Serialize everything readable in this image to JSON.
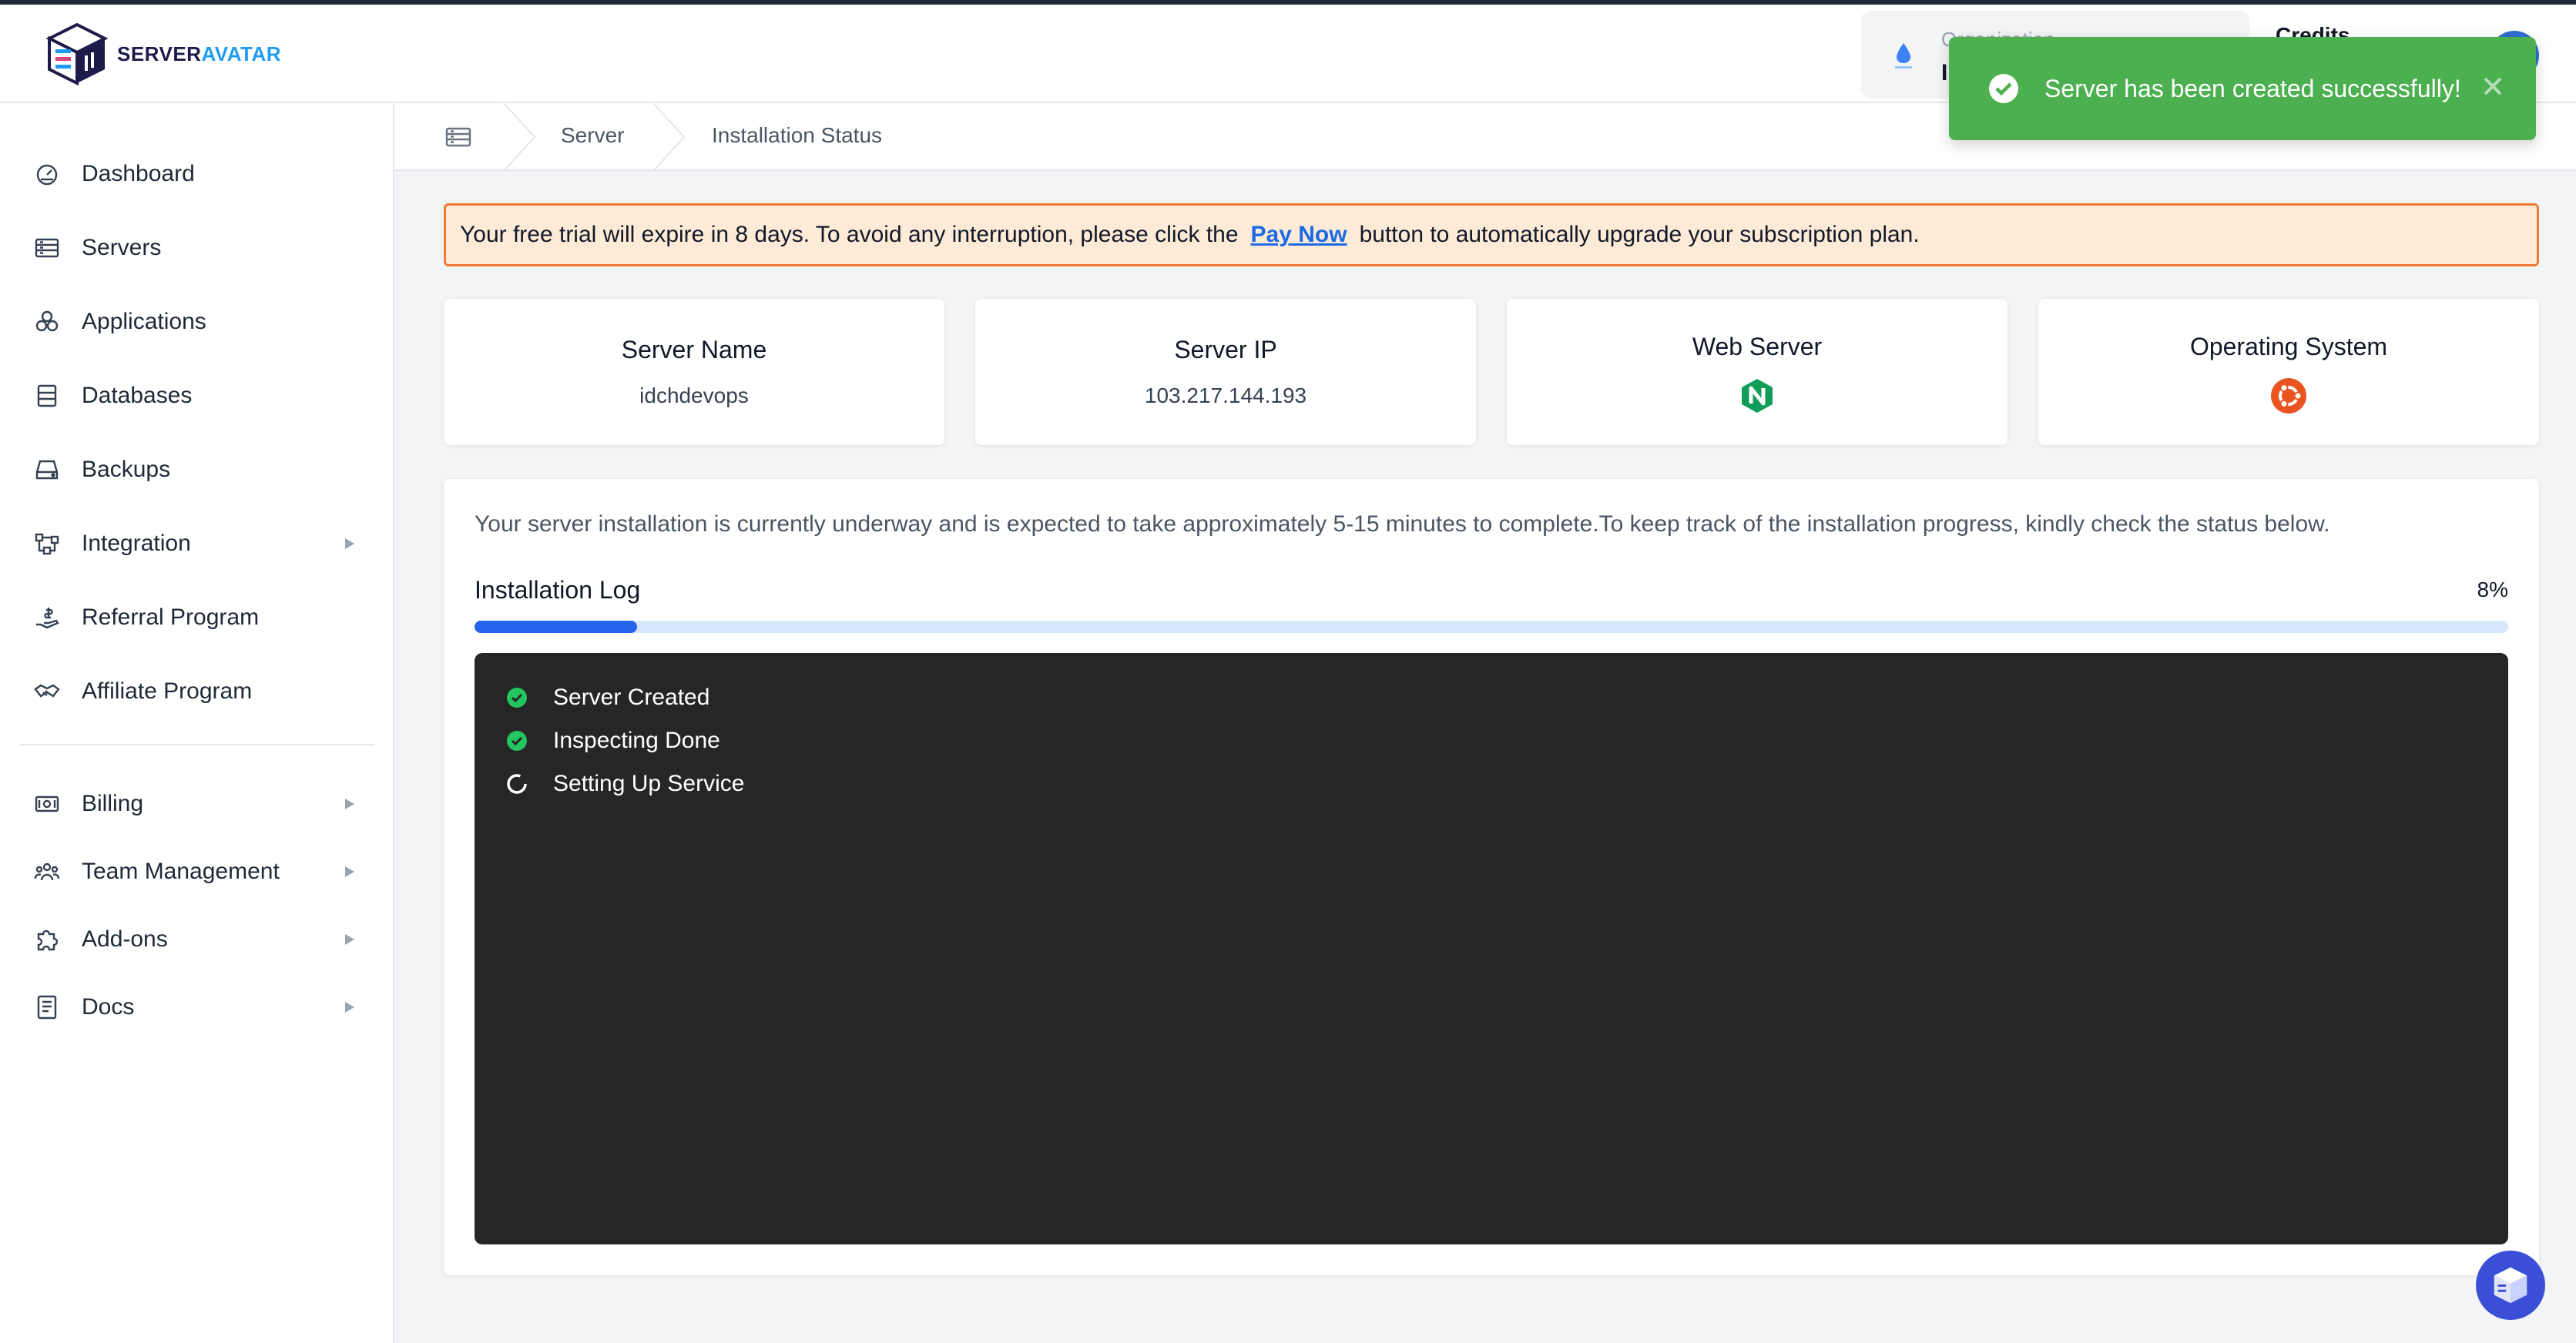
{
  "brand": {
    "name_part1": "SERVER",
    "name_part2": "AVATAR"
  },
  "header": {
    "org_label": "Organization",
    "org_value": "I",
    "credits_label": "Credits"
  },
  "toast": {
    "message": "Server has been created successfully!",
    "color": "#4caf50"
  },
  "sidebar": {
    "items": [
      {
        "label": "Dashboard",
        "icon": "dashboard-icon"
      },
      {
        "label": "Servers",
        "icon": "server-icon"
      },
      {
        "label": "Applications",
        "icon": "applications-icon"
      },
      {
        "label": "Databases",
        "icon": "database-icon"
      },
      {
        "label": "Backups",
        "icon": "backup-icon"
      },
      {
        "label": "Integration",
        "icon": "integration-icon"
      },
      {
        "label": "Referral Program",
        "icon": "referral-icon"
      },
      {
        "label": "Affiliate Program",
        "icon": "affiliate-icon"
      },
      {
        "label": "Billing",
        "icon": "billing-icon"
      },
      {
        "label": "Team Management",
        "icon": "team-icon"
      },
      {
        "label": "Add-ons",
        "icon": "addons-icon"
      },
      {
        "label": "Docs",
        "icon": "docs-icon"
      }
    ]
  },
  "breadcrumb": {
    "server": "Server",
    "current": "Installation Status"
  },
  "trial": {
    "before": "Your free trial will expire in 8 days. To avoid any interruption, please click the",
    "link": "Pay Now",
    "after": "button to automatically upgrade your subscription plan."
  },
  "cards": {
    "server_name": {
      "title": "Server Name",
      "value": "idchdevops"
    },
    "server_ip": {
      "title": "Server IP",
      "value": "103.217.144.193"
    },
    "web_server": {
      "title": "Web Server",
      "icon": "nginx-icon"
    },
    "os": {
      "title": "Operating System",
      "icon": "ubuntu-icon"
    }
  },
  "install": {
    "description": "Your server installation is currently underway and is expected to take approximately 5-15 minutes to complete.To keep track of the installation progress, kindly check the status below.",
    "log_title": "Installation Log",
    "progress_text": "8%",
    "progress": 0.08,
    "steps": [
      {
        "label": "Server Created",
        "status": "done"
      },
      {
        "label": "Inspecting Done",
        "status": "done"
      },
      {
        "label": "Setting Up Service",
        "status": "loading"
      }
    ]
  }
}
